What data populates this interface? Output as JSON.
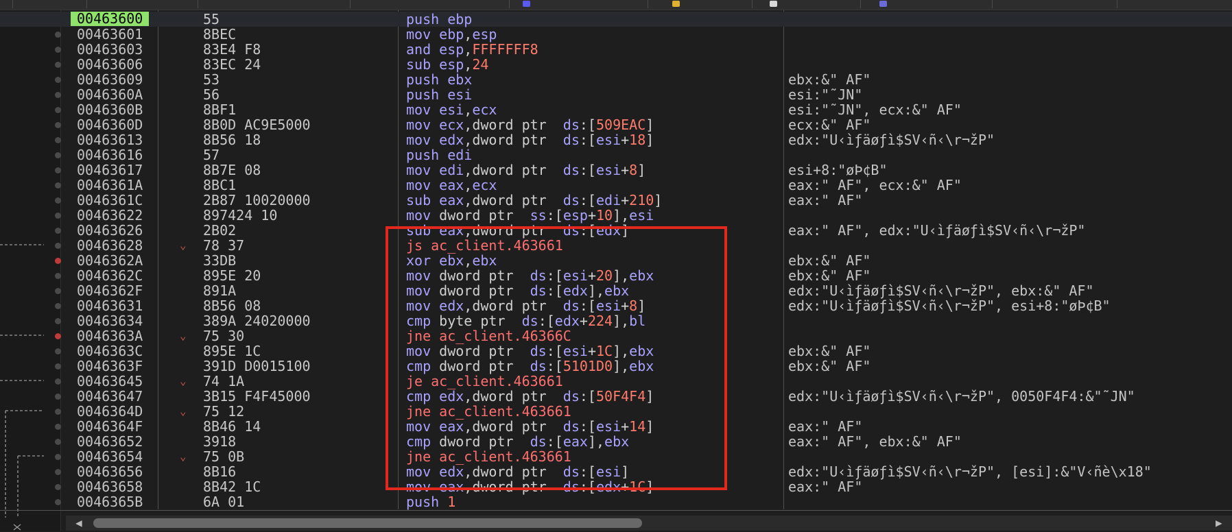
{
  "colors": {
    "background": "#1e1e1e",
    "current_address_bg": "#90e36a",
    "keyword": "#a9a2ff",
    "number": "#ff7b6b",
    "jump": "#ff6f6f",
    "text": "#c8c8c8",
    "highlight_box": "#e3281e"
  },
  "rows": [
    {
      "addr": "00463600",
      "bytes": "55",
      "comment": "",
      "current": true,
      "bp": "none",
      "chevron": false
    },
    {
      "addr": "00463601",
      "bytes": "8BEC",
      "comment": "",
      "bp": "dot",
      "chevron": false
    },
    {
      "addr": "00463603",
      "bytes": "83E4 F8",
      "comment": "",
      "bp": "dot",
      "chevron": false
    },
    {
      "addr": "00463606",
      "bytes": "83EC 24",
      "comment": "",
      "bp": "dot",
      "chevron": false
    },
    {
      "addr": "00463609",
      "bytes": "53",
      "comment": "ebx:&\" AF\"",
      "bp": "dot",
      "chevron": false
    },
    {
      "addr": "0046360A",
      "bytes": "56",
      "comment": "esi:\"˜JN\"",
      "bp": "dot",
      "chevron": false
    },
    {
      "addr": "0046360B",
      "bytes": "8BF1",
      "comment": "esi:\"˜JN\", ecx:&\" AF\"",
      "bp": "dot",
      "chevron": false
    },
    {
      "addr": "0046360D",
      "bytes": "8B0D AC9E5000",
      "comment": "ecx:&\" AF\"",
      "bp": "dot",
      "chevron": false
    },
    {
      "addr": "00463613",
      "bytes": "8B56 18",
      "comment": "edx:\"U‹ìƒäøƒì$SV‹ñ‹\\r¬žP\"",
      "bp": "dot",
      "chevron": false
    },
    {
      "addr": "00463616",
      "bytes": "57",
      "comment": "",
      "bp": "dot",
      "chevron": false
    },
    {
      "addr": "00463617",
      "bytes": "8B7E 08",
      "comment": "esi+8:\"øÞ¢B\"",
      "bp": "dot",
      "chevron": false
    },
    {
      "addr": "0046361A",
      "bytes": "8BC1",
      "comment": "eax:\" AF\", ecx:&\" AF\"",
      "bp": "dot",
      "chevron": false
    },
    {
      "addr": "0046361C",
      "bytes": "2B87 10020000",
      "comment": "eax:\" AF\"",
      "bp": "dot",
      "chevron": false
    },
    {
      "addr": "00463622",
      "bytes": "897424 10",
      "comment": "",
      "bp": "dot",
      "chevron": false
    },
    {
      "addr": "00463626",
      "bytes": "2B02",
      "comment": "eax:\" AF\", edx:\"U‹ìƒäøƒì$SV‹ñ‹\\r¬žP\"",
      "bp": "dot",
      "chevron": false
    },
    {
      "addr": "00463628",
      "bytes": "78 37",
      "comment": "",
      "bp": "dot",
      "chevron": true
    },
    {
      "addr": "0046362A",
      "bytes": "33DB",
      "comment": "ebx:&\" AF\"",
      "bp": "active",
      "chevron": false
    },
    {
      "addr": "0046362C",
      "bytes": "895E 20",
      "comment": "ebx:&\" AF\"",
      "bp": "dot",
      "chevron": false
    },
    {
      "addr": "0046362F",
      "bytes": "891A",
      "comment": "edx:\"U‹ìƒäøƒì$SV‹ñ‹\\r¬žP\", ebx:&\" AF\"",
      "bp": "dot",
      "chevron": false
    },
    {
      "addr": "00463631",
      "bytes": "8B56 08",
      "comment": "edx:\"U‹ìƒäøƒì$SV‹ñ‹\\r¬žP\", esi+8:\"øÞ¢B\"",
      "bp": "dot",
      "chevron": false
    },
    {
      "addr": "00463634",
      "bytes": "389A 24020000",
      "comment": "",
      "bp": "dot",
      "chevron": false
    },
    {
      "addr": "0046363A",
      "bytes": "75 30",
      "comment": "",
      "bp": "active",
      "chevron": true
    },
    {
      "addr": "0046363C",
      "bytes": "895E 1C",
      "comment": "ebx:&\" AF\"",
      "bp": "dot",
      "chevron": false
    },
    {
      "addr": "0046363F",
      "bytes": "391D D0015100",
      "comment": "ebx:&\" AF\"",
      "bp": "dot",
      "chevron": false
    },
    {
      "addr": "00463645",
      "bytes": "74 1A",
      "comment": "",
      "bp": "dot",
      "chevron": true
    },
    {
      "addr": "00463647",
      "bytes": "3B15 F4F45000",
      "comment": "edx:\"U‹ìƒäøƒì$SV‹ñ‹\\r¬žP\", 0050F4F4:&\"˜JN\"",
      "bp": "dot",
      "chevron": false
    },
    {
      "addr": "0046364D",
      "bytes": "75 12",
      "comment": "",
      "bp": "dot",
      "chevron": true
    },
    {
      "addr": "0046364F",
      "bytes": "8B46 14",
      "comment": "eax:\" AF\"",
      "bp": "dot",
      "chevron": false
    },
    {
      "addr": "00463652",
      "bytes": "3918",
      "comment": "eax:\" AF\", ebx:&\" AF\"",
      "bp": "dot",
      "chevron": false
    },
    {
      "addr": "00463654",
      "bytes": "75 0B",
      "comment": "",
      "bp": "dot",
      "chevron": true
    },
    {
      "addr": "00463656",
      "bytes": "8B16",
      "comment": "edx:\"U‹ìƒäøƒì$SV‹ñ‹\\r¬žP\", [esi]:&\"V‹ñè\\x18\"",
      "bp": "dot",
      "chevron": false
    },
    {
      "addr": "00463658",
      "bytes": "8B42 1C",
      "comment": "eax:\" AF\"",
      "bp": "dot",
      "chevron": false
    },
    {
      "addr": "0046365B",
      "bytes": "6A 01",
      "comment": "",
      "bp": "dot",
      "chevron": false
    }
  ],
  "disasm": [
    [
      [
        "push ",
        "kw"
      ],
      [
        "ebp",
        "kw"
      ]
    ],
    [
      [
        "mov ",
        "kw"
      ],
      [
        "ebp",
        "kw"
      ],
      [
        ",",
        "def"
      ],
      [
        "esp",
        "kw"
      ]
    ],
    [
      [
        "and ",
        "kw"
      ],
      [
        "esp",
        "kw"
      ],
      [
        ",",
        "def"
      ],
      [
        "FFFFFFF8",
        "num"
      ]
    ],
    [
      [
        "sub ",
        "kw"
      ],
      [
        "esp",
        "kw"
      ],
      [
        ",",
        "def"
      ],
      [
        "24",
        "num"
      ]
    ],
    [
      [
        "push ",
        "kw"
      ],
      [
        "ebx",
        "kw"
      ]
    ],
    [
      [
        "push ",
        "kw"
      ],
      [
        "esi",
        "kw"
      ]
    ],
    [
      [
        "mov ",
        "kw"
      ],
      [
        "esi",
        "kw"
      ],
      [
        ",",
        "def"
      ],
      [
        "ecx",
        "kw"
      ]
    ],
    [
      [
        "mov ",
        "kw"
      ],
      [
        "ecx",
        "kw"
      ],
      [
        ",dword ptr  ",
        "def"
      ],
      [
        "ds",
        "kw"
      ],
      [
        ":[",
        "def"
      ],
      [
        "509EAC",
        "num"
      ],
      [
        "]",
        "def"
      ]
    ],
    [
      [
        "mov ",
        "kw"
      ],
      [
        "edx",
        "kw"
      ],
      [
        ",dword ptr  ",
        "def"
      ],
      [
        "ds",
        "kw"
      ],
      [
        ":[",
        "def"
      ],
      [
        "esi",
        "kw"
      ],
      [
        "+",
        "def"
      ],
      [
        "18",
        "num"
      ],
      [
        "]",
        "def"
      ]
    ],
    [
      [
        "push ",
        "kw"
      ],
      [
        "edi",
        "kw"
      ]
    ],
    [
      [
        "mov ",
        "kw"
      ],
      [
        "edi",
        "kw"
      ],
      [
        ",dword ptr  ",
        "def"
      ],
      [
        "ds",
        "kw"
      ],
      [
        ":[",
        "def"
      ],
      [
        "esi",
        "kw"
      ],
      [
        "+",
        "def"
      ],
      [
        "8",
        "num"
      ],
      [
        "]",
        "def"
      ]
    ],
    [
      [
        "mov ",
        "kw"
      ],
      [
        "eax",
        "kw"
      ],
      [
        ",",
        "def"
      ],
      [
        "ecx",
        "kw"
      ]
    ],
    [
      [
        "sub ",
        "kw"
      ],
      [
        "eax",
        "kw"
      ],
      [
        ",dword ptr  ",
        "def"
      ],
      [
        "ds",
        "kw"
      ],
      [
        ":[",
        "def"
      ],
      [
        "edi",
        "kw"
      ],
      [
        "+",
        "def"
      ],
      [
        "210",
        "num"
      ],
      [
        "]",
        "def"
      ]
    ],
    [
      [
        "mov ",
        "kw"
      ],
      [
        "dword ptr  ",
        "def"
      ],
      [
        "ss",
        "kw"
      ],
      [
        ":[",
        "def"
      ],
      [
        "esp",
        "kw"
      ],
      [
        "+",
        "def"
      ],
      [
        "10",
        "num"
      ],
      [
        "],",
        "def"
      ],
      [
        "esi",
        "kw"
      ]
    ],
    [
      [
        "sub ",
        "kw"
      ],
      [
        "eax",
        "kw"
      ],
      [
        ",dword ptr  ",
        "def"
      ],
      [
        "ds",
        "kw"
      ],
      [
        ":[",
        "def"
      ],
      [
        "edx",
        "kw"
      ],
      [
        "]",
        "def"
      ]
    ],
    [
      [
        "js ",
        "jmp"
      ],
      [
        "ac_client.463661",
        "jmp"
      ]
    ],
    [
      [
        "xor ",
        "kw"
      ],
      [
        "ebx",
        "kw"
      ],
      [
        ",",
        "def"
      ],
      [
        "ebx",
        "kw"
      ]
    ],
    [
      [
        "mov ",
        "kw"
      ],
      [
        "dword ptr  ",
        "def"
      ],
      [
        "ds",
        "kw"
      ],
      [
        ":[",
        "def"
      ],
      [
        "esi",
        "kw"
      ],
      [
        "+",
        "def"
      ],
      [
        "20",
        "num"
      ],
      [
        "],",
        "def"
      ],
      [
        "ebx",
        "kw"
      ]
    ],
    [
      [
        "mov ",
        "kw"
      ],
      [
        "dword ptr  ",
        "def"
      ],
      [
        "ds",
        "kw"
      ],
      [
        ":[",
        "def"
      ],
      [
        "edx",
        "kw"
      ],
      [
        "],",
        "def"
      ],
      [
        "ebx",
        "kw"
      ]
    ],
    [
      [
        "mov ",
        "kw"
      ],
      [
        "edx",
        "kw"
      ],
      [
        ",dword ptr  ",
        "def"
      ],
      [
        "ds",
        "kw"
      ],
      [
        ":[",
        "def"
      ],
      [
        "esi",
        "kw"
      ],
      [
        "+",
        "def"
      ],
      [
        "8",
        "num"
      ],
      [
        "]",
        "def"
      ]
    ],
    [
      [
        "cmp ",
        "kw"
      ],
      [
        "byte ptr  ",
        "def"
      ],
      [
        "ds",
        "kw"
      ],
      [
        ":[",
        "def"
      ],
      [
        "edx",
        "kw"
      ],
      [
        "+",
        "def"
      ],
      [
        "224",
        "num"
      ],
      [
        "],",
        "def"
      ],
      [
        "bl",
        "kw"
      ]
    ],
    [
      [
        "jne ",
        "jmp"
      ],
      [
        "ac_client.46366C",
        "jmp"
      ]
    ],
    [
      [
        "mov ",
        "kw"
      ],
      [
        "dword ptr  ",
        "def"
      ],
      [
        "ds",
        "kw"
      ],
      [
        ":[",
        "def"
      ],
      [
        "esi",
        "kw"
      ],
      [
        "+",
        "def"
      ],
      [
        "1C",
        "num"
      ],
      [
        "],",
        "def"
      ],
      [
        "ebx",
        "kw"
      ]
    ],
    [
      [
        "cmp ",
        "kw"
      ],
      [
        "dword ptr  ",
        "def"
      ],
      [
        "ds",
        "kw"
      ],
      [
        ":[",
        "def"
      ],
      [
        "5101D0",
        "num"
      ],
      [
        "],",
        "def"
      ],
      [
        "ebx",
        "kw"
      ]
    ],
    [
      [
        "je ",
        "jmp"
      ],
      [
        "ac_client.463661",
        "jmp"
      ]
    ],
    [
      [
        "cmp ",
        "kw"
      ],
      [
        "edx",
        "kw"
      ],
      [
        ",dword ptr  ",
        "def"
      ],
      [
        "ds",
        "kw"
      ],
      [
        ":[",
        "def"
      ],
      [
        "50F4F4",
        "num"
      ],
      [
        "]",
        "def"
      ]
    ],
    [
      [
        "jne ",
        "jmp"
      ],
      [
        "ac_client.463661",
        "jmp"
      ]
    ],
    [
      [
        "mov ",
        "kw"
      ],
      [
        "eax",
        "kw"
      ],
      [
        ",dword ptr  ",
        "def"
      ],
      [
        "ds",
        "kw"
      ],
      [
        ":[",
        "def"
      ],
      [
        "esi",
        "kw"
      ],
      [
        "+",
        "def"
      ],
      [
        "14",
        "num"
      ],
      [
        "]",
        "def"
      ]
    ],
    [
      [
        "cmp ",
        "kw"
      ],
      [
        "dword ptr  ",
        "def"
      ],
      [
        "ds",
        "kw"
      ],
      [
        ":[",
        "def"
      ],
      [
        "eax",
        "kw"
      ],
      [
        "],",
        "def"
      ],
      [
        "ebx",
        "kw"
      ]
    ],
    [
      [
        "jne ",
        "jmp"
      ],
      [
        "ac_client.463661",
        "jmp"
      ]
    ],
    [
      [
        "mov ",
        "kw"
      ],
      [
        "edx",
        "kw"
      ],
      [
        ",dword ptr  ",
        "def"
      ],
      [
        "ds",
        "kw"
      ],
      [
        ":[",
        "def"
      ],
      [
        "esi",
        "kw"
      ],
      [
        "]",
        "def"
      ]
    ],
    [
      [
        "mov ",
        "kw"
      ],
      [
        "eax",
        "kw"
      ],
      [
        ",dword ptr  ",
        "def"
      ],
      [
        "ds",
        "kw"
      ],
      [
        ":[",
        "def"
      ],
      [
        "edx",
        "kw"
      ],
      [
        "+",
        "def"
      ],
      [
        "1C",
        "num"
      ],
      [
        "]",
        "def"
      ]
    ],
    [
      [
        "push ",
        "kw"
      ],
      [
        "1",
        "num"
      ]
    ]
  ],
  "scrollbar": {
    "left_arrow_icon": "◀",
    "right_arrow_icon": "▶"
  }
}
